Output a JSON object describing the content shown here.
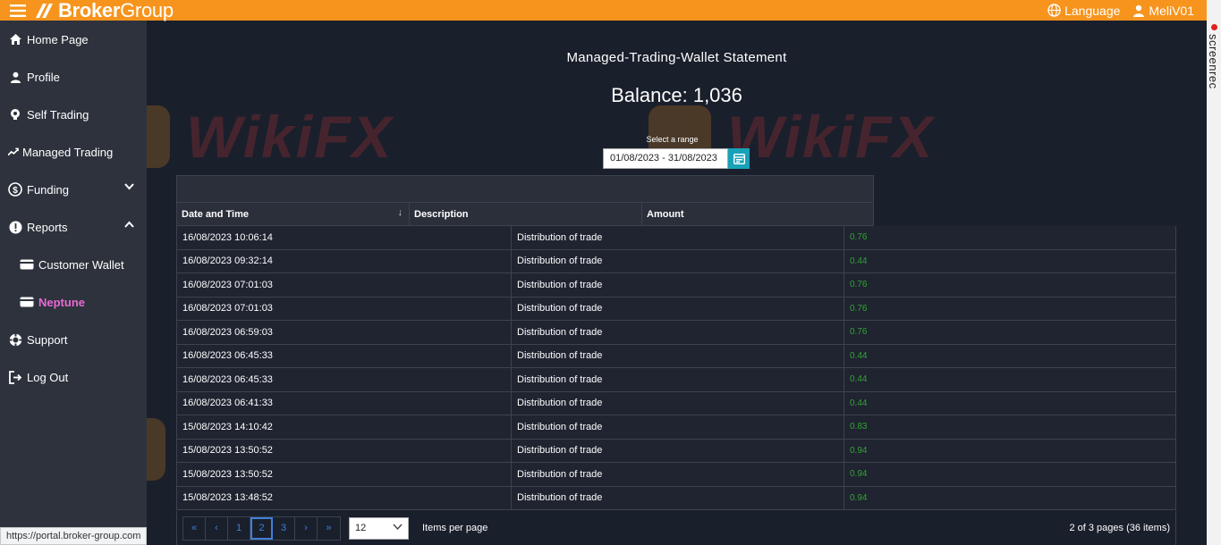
{
  "header": {
    "brand_bold": "Broker",
    "brand_light": "Group",
    "language_label": "Language",
    "user_label": "MeliV01"
  },
  "screenrec": {
    "label": "screenrec"
  },
  "sidebar": {
    "items": [
      {
        "label": "Home Page",
        "icon": "home-icon"
      },
      {
        "label": "Profile",
        "icon": "user-icon"
      },
      {
        "label": "Self Trading",
        "icon": "self-trading-icon"
      },
      {
        "label": "Managed Trading",
        "icon": "trend-icon"
      },
      {
        "label": "Funding",
        "icon": "funding-icon"
      },
      {
        "label": "Reports",
        "icon": "alert-icon"
      },
      {
        "label": "Customer Wallet",
        "icon": "wallet-icon"
      },
      {
        "label": "Neptune",
        "icon": "wallet-icon"
      },
      {
        "label": "Support",
        "icon": "lifebuoy-icon"
      },
      {
        "label": "Log Out",
        "icon": "logout-icon"
      }
    ]
  },
  "main": {
    "title": "Managed-Trading-Wallet Statement",
    "balance": "Balance: 1,036",
    "range_label": "Select a range",
    "range_value": "01/08/2023 - 31/08/2023"
  },
  "table": {
    "columns": [
      "Date and Time",
      "Description",
      "Amount"
    ],
    "rows": [
      {
        "date": "16/08/2023 10:06:14",
        "desc": "Distribution of trade",
        "amount": "0.76"
      },
      {
        "date": "16/08/2023 09:32:14",
        "desc": "Distribution of trade",
        "amount": "0.44"
      },
      {
        "date": "16/08/2023 07:01:03",
        "desc": "Distribution of trade",
        "amount": "0.76"
      },
      {
        "date": "16/08/2023 07:01:03",
        "desc": "Distribution of trade",
        "amount": "0.76"
      },
      {
        "date": "16/08/2023 06:59:03",
        "desc": "Distribution of trade",
        "amount": "0.76"
      },
      {
        "date": "16/08/2023 06:45:33",
        "desc": "Distribution of trade",
        "amount": "0.44"
      },
      {
        "date": "16/08/2023 06:45:33",
        "desc": "Distribution of trade",
        "amount": "0.44"
      },
      {
        "date": "16/08/2023 06:41:33",
        "desc": "Distribution of trade",
        "amount": "0.44"
      },
      {
        "date": "15/08/2023 14:10:42",
        "desc": "Distribution of trade",
        "amount": "0.83"
      },
      {
        "date": "15/08/2023 13:50:52",
        "desc": "Distribution of trade",
        "amount": "0.94"
      },
      {
        "date": "15/08/2023 13:50:52",
        "desc": "Distribution of trade",
        "amount": "0.94"
      },
      {
        "date": "15/08/2023 13:48:52",
        "desc": "Distribution of trade",
        "amount": "0.94"
      }
    ]
  },
  "pager": {
    "first": "«",
    "prev": "‹",
    "pages": [
      "1",
      "2",
      "3"
    ],
    "next": "›",
    "last": "»",
    "per_page": "12",
    "per_page_label": "Items per page",
    "info": "2 of 3 pages (36 items)"
  },
  "status_url": "https://portal.broker-group.com",
  "colors": {
    "accent": "#f7941d",
    "amount_positive": "#33a333",
    "active_nav": "#e86bd3",
    "pager_blue": "#3f7fd8"
  }
}
